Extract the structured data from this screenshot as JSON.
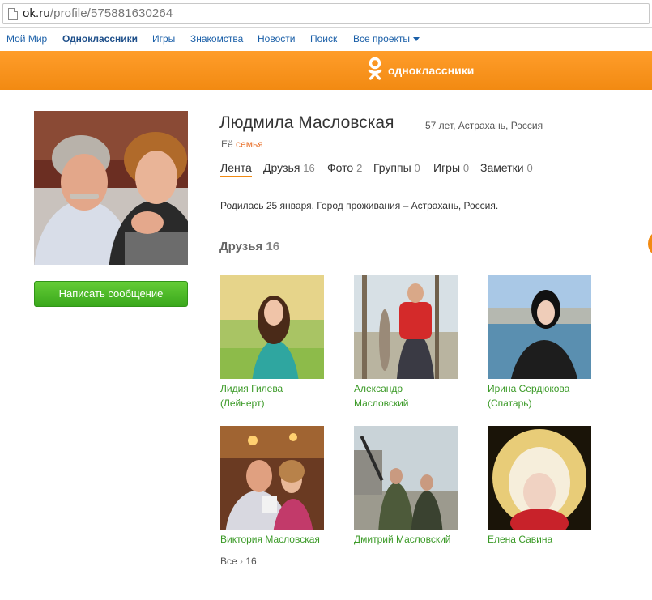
{
  "browser": {
    "url_host": "ok.ru",
    "url_path": "/profile/575881630264"
  },
  "portal_nav": {
    "items": [
      "Мой Мир",
      "Одноклассники",
      "Игры",
      "Знакомства",
      "Новости",
      "Поиск",
      "Все проекты"
    ]
  },
  "header": {
    "logo_text": "одноклассники",
    "accent": "#f28a12"
  },
  "profile": {
    "name": "Людмила Масловская",
    "meta": "57 лет, Астрахань, Россия",
    "family_prefix": "Её",
    "family_link": "семья",
    "about": "Родилась 25 января. Город проживания – Астрахань, Россия.",
    "message_button": "Написать сообщение"
  },
  "tabs": [
    {
      "label": "Лента",
      "count": ""
    },
    {
      "label": "Друзья",
      "count": "16"
    },
    {
      "label": "Фото",
      "count": "2"
    },
    {
      "label": "Группы",
      "count": "0"
    },
    {
      "label": "Игры",
      "count": "0"
    },
    {
      "label": "Заметки",
      "count": "0"
    }
  ],
  "friends": {
    "title": "Друзья",
    "count": "16",
    "items": [
      {
        "name": "Лидия Гилева (Лейнерт)"
      },
      {
        "name": "Александр Масловский"
      },
      {
        "name": "Ирина Сердюкова (Спатарь)"
      },
      {
        "name": "Виктория Масловская"
      },
      {
        "name": "Дмитрий Масловский"
      },
      {
        "name": "Елена Савина"
      }
    ],
    "all_label": "Все",
    "all_count": "16"
  }
}
